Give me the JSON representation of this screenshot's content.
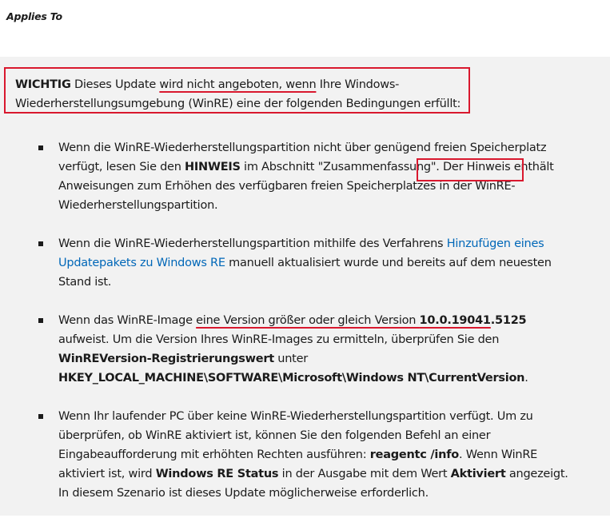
{
  "applies_to": "Applies To",
  "important": {
    "label": "WICHTIG",
    "text_1": " Dieses Update ",
    "text_underlined": "wird nicht angeboten, wenn",
    "text_2": " Ihre Windows-Wiederherstellungsumgebung (WinRE) eine der folgenden Bedingungen erfüllt:"
  },
  "items": [
    {
      "t1": "Wenn die WinRE-Wiederherstellungspartition nicht über genügend freien Speicherplatz verfügt, lesen Sie den ",
      "b1": "HINWEIS",
      "t2": " im Abschnitt \"Zusammenfassung\". Der Hinweis enthält Anweisungen zum Erhöhen des verfügbaren freien Speicherplatzes in der WinRE-Wiederherstellungspartition."
    },
    {
      "t1": "Wenn die WinRE-Wiederherstellungspartition mithilfe des Verfahrens ",
      "link": "Hinzufügen eines Updatepakets zu Windows RE",
      "t2": " manuell aktualisiert wurde und bereits auf dem neuesten Stand ist."
    },
    {
      "t1": "Wenn das WinRE-Image ",
      "u1": "eine Version größer oder gleich Version ",
      "b_version": "10.0.19041",
      "b_version_suffix": ".5125",
      "t2": " aufweist. Um die Version Ihres WinRE-Images zu ermitteln, überprüfen Sie den ",
      "b1": "WinREVersion-Registrierungswert",
      "t3": " unter ",
      "b2": "HKEY_LOCAL_MACHINE\\SOFTWARE\\Microsoft\\Windows NT\\CurrentVersion",
      "t4": "."
    },
    {
      "t1": "Wenn Ihr laufender PC über keine WinRE-Wiederherstellungspartition verfügt. Um zu überprüfen, ob WinRE aktiviert ist, können Sie den folgenden Befehl an einer Eingabeaufforderung mit erhöhten Rechten ausführen: ",
      "b1": "reagentc /info",
      "t2": ". Wenn WinRE aktiviert ist, wird ",
      "b2": "Windows RE Status",
      "t3": " in der Ausgabe mit dem Wert ",
      "b3": "Aktiviert",
      "t4": " angezeigt. In diesem Szenario ist dieses Update möglicherweise erforderlich."
    }
  ],
  "colors": {
    "highlight_red": "#d9182e",
    "link_blue": "#0067b8",
    "panel_bg": "#f2f2f2"
  }
}
